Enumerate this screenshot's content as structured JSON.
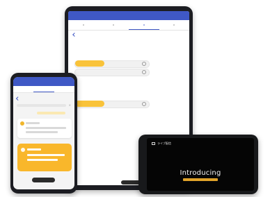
{
  "colors": {
    "accent_blue": "#3f58c5",
    "accent_yellow": "#f9b72b",
    "device_frame": "#1c1d22"
  },
  "landscape": {
    "header_icon": "monitor-icon",
    "header_label": "ライブ配信",
    "title": "Introducing"
  }
}
